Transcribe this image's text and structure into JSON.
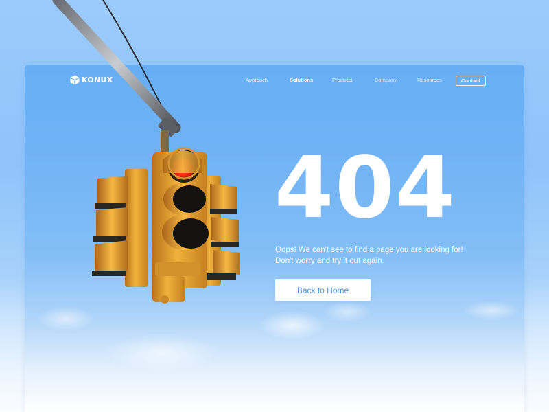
{
  "brand": {
    "name": "KONUX",
    "logo_icon": "cube-logo-icon"
  },
  "nav": {
    "links": [
      {
        "label": "Approach",
        "active": false
      },
      {
        "label": "Solutions",
        "active": true
      },
      {
        "label": "Products",
        "active": false
      },
      {
        "label": "Company",
        "active": false
      },
      {
        "label": "Resources",
        "active": false
      }
    ],
    "contact_label": "Contact"
  },
  "hero": {
    "code": "404",
    "message": "Oops! We can't see to find a page you are looking for! Don't worry and try it out again.",
    "button_label": "Back to Home",
    "illustration": "traffic-light-illustration"
  },
  "colors": {
    "sky_top": "#67aef4",
    "accent_text": "#4a94e8",
    "traffic_light_body": "#e9a32c",
    "red_signal": "#ff2a1c"
  }
}
